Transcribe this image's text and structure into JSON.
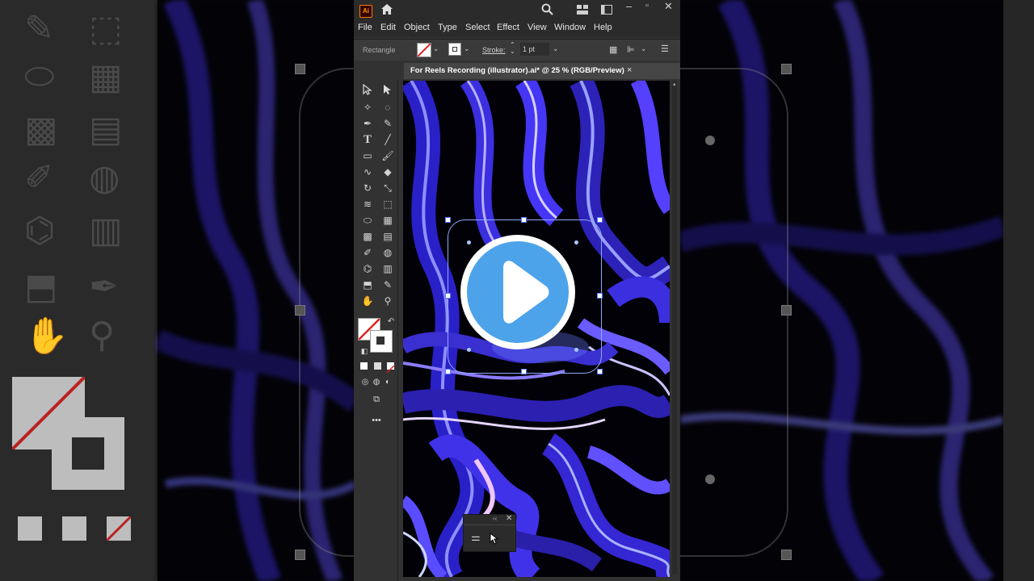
{
  "app": {
    "logo": "Ai",
    "menu": [
      "File",
      "Edit",
      "Object",
      "Type",
      "Select",
      "Effect",
      "View",
      "Window",
      "Help"
    ]
  },
  "control_bar": {
    "object_type": "Rectangle",
    "stroke_label": "Stroke:",
    "stroke_value": "1 pt"
  },
  "document": {
    "tab_title": "For Reels Recording (illustrator).ai* @ 25 % (RGB/Preview)",
    "close_glyph": "×"
  },
  "colors": {
    "accent": "#4da3ea",
    "play_triangle": "#ffffff",
    "selection": "#8faaff",
    "swirl_blue": "#3a2bd8",
    "swirl_violet": "#6b4cff"
  },
  "icons": {
    "home": "home-icon",
    "search": "search-icon",
    "workspace": "workspace-icon",
    "arrange": "arrange-documents-icon"
  }
}
